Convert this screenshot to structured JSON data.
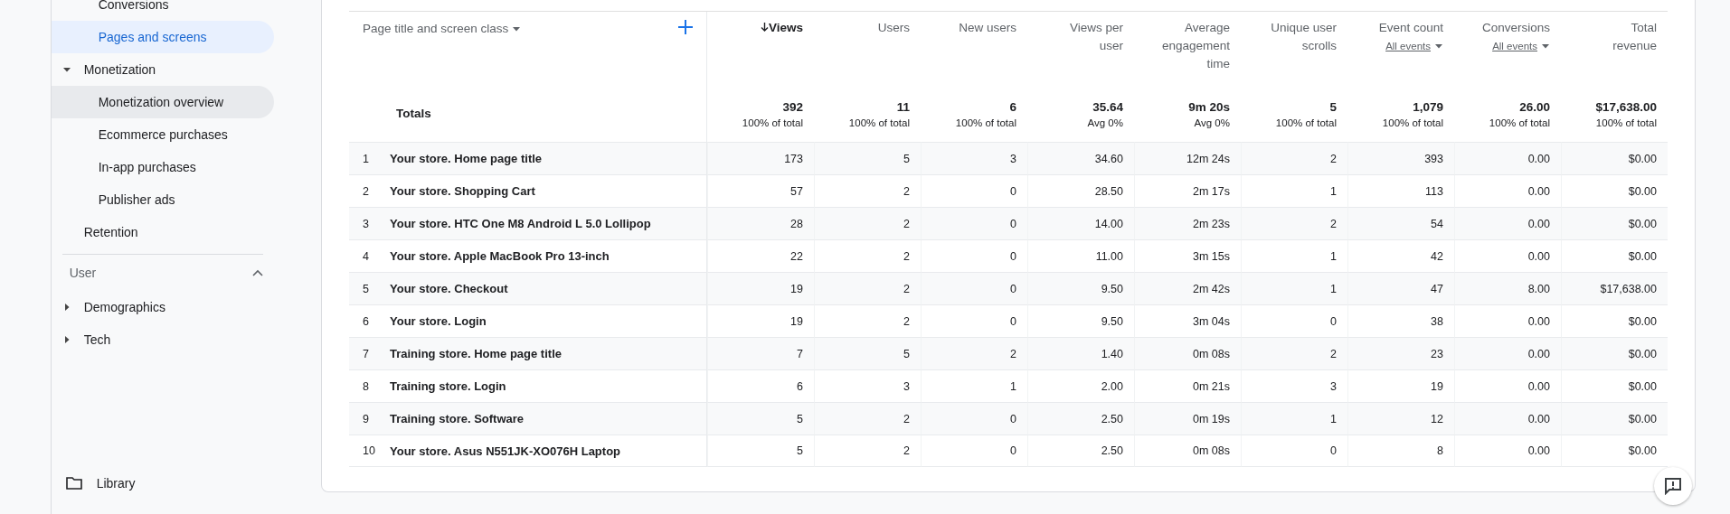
{
  "sidebar": {
    "nav": [
      {
        "kind": "child",
        "label": "Conversions",
        "selected": false,
        "hovered": false
      },
      {
        "kind": "child",
        "label": "Pages and screens",
        "selected": true,
        "hovered": false
      },
      {
        "kind": "group",
        "label": "Monetization",
        "expanded": true,
        "children": [
          {
            "label": "Monetization overview",
            "selected": false,
            "hovered": true
          },
          {
            "label": "Ecommerce purchases",
            "selected": false,
            "hovered": false
          },
          {
            "label": "In-app purchases",
            "selected": false,
            "hovered": false
          },
          {
            "label": "Publisher ads",
            "selected": false,
            "hovered": false
          }
        ]
      },
      {
        "kind": "leaf",
        "label": "Retention",
        "selected": false,
        "hovered": false
      }
    ],
    "section": {
      "title": "User",
      "expanded": true,
      "items": [
        {
          "label": "Demographics",
          "expanded": false
        },
        {
          "label": "Tech",
          "expanded": false
        }
      ]
    },
    "library": {
      "label": "Library"
    }
  },
  "table": {
    "dimension": "Page title and screen class",
    "columns": [
      {
        "label": "Views",
        "sorted": true
      },
      {
        "label": "Users",
        "sorted": false
      },
      {
        "label": "New users",
        "sorted": false
      },
      {
        "label": "Views per user",
        "sorted": false
      },
      {
        "label": "Average engagement time",
        "sorted": false
      },
      {
        "label": "Unique user scrolls",
        "sorted": false
      },
      {
        "label": "Event count",
        "sorted": false,
        "filter": "All events"
      },
      {
        "label": "Conversions",
        "sorted": false,
        "filter": "All events"
      },
      {
        "label": "Total revenue",
        "sorted": false
      }
    ],
    "totals": {
      "label": "Totals",
      "values": [
        {
          "value": "392",
          "note": "100% of total"
        },
        {
          "value": "11",
          "note": "100% of total"
        },
        {
          "value": "6",
          "note": "100% of total"
        },
        {
          "value": "35.64",
          "note": "Avg 0%"
        },
        {
          "value": "9m 20s",
          "note": "Avg 0%"
        },
        {
          "value": "5",
          "note": "100% of total"
        },
        {
          "value": "1,079",
          "note": "100% of total"
        },
        {
          "value": "26.00",
          "note": "100% of total"
        },
        {
          "value": "$17,638.00",
          "note": "100% of total"
        }
      ]
    },
    "rows": [
      {
        "index": "1",
        "name": "Your store. Home page title",
        "values": [
          "173",
          "5",
          "3",
          "34.60",
          "12m 24s",
          "2",
          "393",
          "0.00",
          "$0.00"
        ]
      },
      {
        "index": "2",
        "name": "Your store. Shopping Cart",
        "values": [
          "57",
          "2",
          "0",
          "28.50",
          "2m 17s",
          "1",
          "113",
          "0.00",
          "$0.00"
        ]
      },
      {
        "index": "3",
        "name": "Your store. HTC One M8 Android L 5.0 Lollipop",
        "values": [
          "28",
          "2",
          "0",
          "14.00",
          "2m 23s",
          "2",
          "54",
          "0.00",
          "$0.00"
        ]
      },
      {
        "index": "4",
        "name": "Your store. Apple MacBook Pro 13-inch",
        "values": [
          "22",
          "2",
          "0",
          "11.00",
          "3m 15s",
          "1",
          "42",
          "0.00",
          "$0.00"
        ]
      },
      {
        "index": "5",
        "name": "Your store. Checkout",
        "values": [
          "19",
          "2",
          "0",
          "9.50",
          "2m 42s",
          "1",
          "47",
          "8.00",
          "$17,638.00"
        ]
      },
      {
        "index": "6",
        "name": "Your store. Login",
        "values": [
          "19",
          "2",
          "0",
          "9.50",
          "3m 04s",
          "0",
          "38",
          "0.00",
          "$0.00"
        ]
      },
      {
        "index": "7",
        "name": "Training store. Home page title",
        "values": [
          "7",
          "5",
          "2",
          "1.40",
          "0m 08s",
          "2",
          "23",
          "0.00",
          "$0.00"
        ]
      },
      {
        "index": "8",
        "name": "Training store. Login",
        "values": [
          "6",
          "3",
          "1",
          "2.00",
          "0m 21s",
          "3",
          "19",
          "0.00",
          "$0.00"
        ]
      },
      {
        "index": "9",
        "name": "Training store. Software",
        "values": [
          "5",
          "2",
          "0",
          "2.50",
          "0m 19s",
          "1",
          "12",
          "0.00",
          "$0.00"
        ]
      },
      {
        "index": "10",
        "name": "Your store. Asus N551JK-XO076H Laptop",
        "values": [
          "5",
          "2",
          "0",
          "2.50",
          "0m 08s",
          "0",
          "8",
          "0.00",
          "$0.00"
        ]
      }
    ]
  }
}
